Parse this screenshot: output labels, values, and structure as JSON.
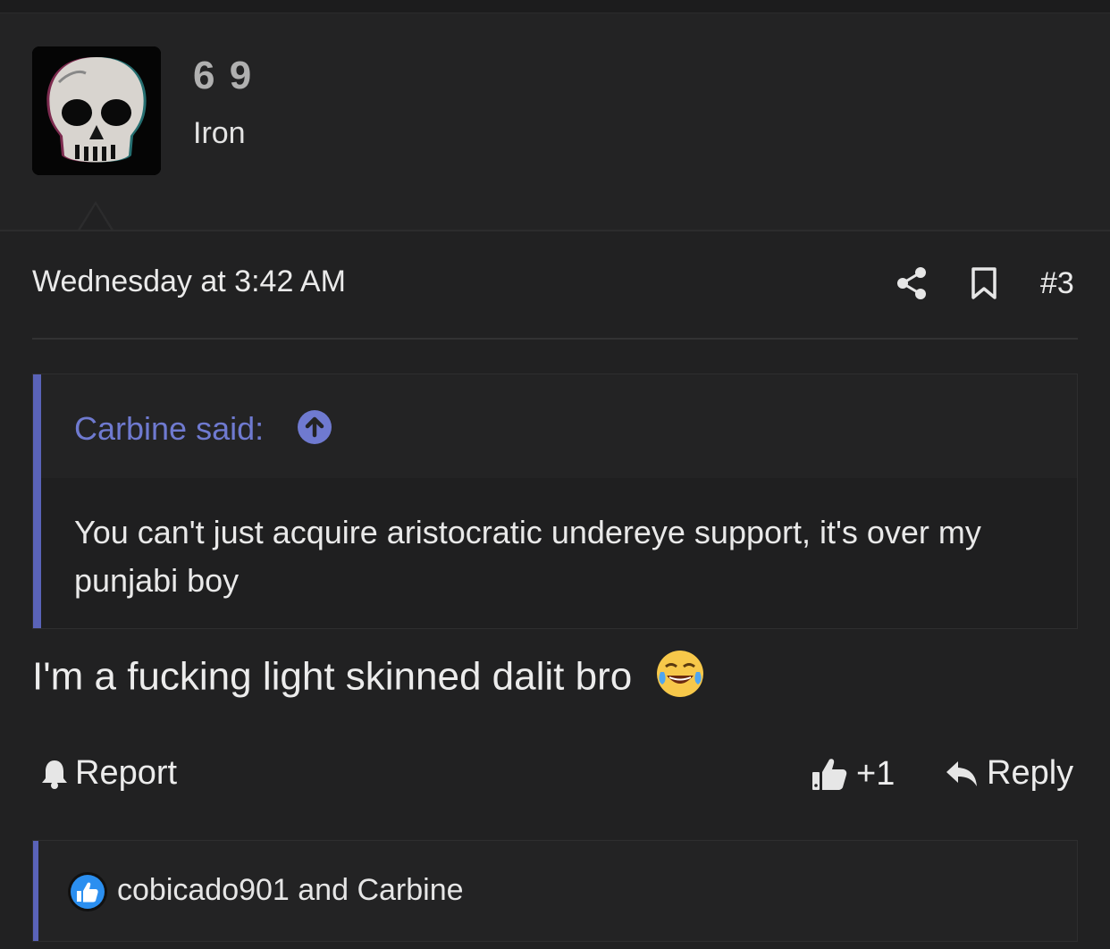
{
  "user": {
    "name": "6 9",
    "title": "Iron",
    "avatar_icon": "skull-avatar"
  },
  "post": {
    "date": "Wednesday at 3:42 AM",
    "number": "#3",
    "icons": [
      "share-icon",
      "bookmark-icon"
    ]
  },
  "quote": {
    "author": "Carbine said:",
    "text": "You can't just acquire aristocratic undereye support, it's over my punjabi boy",
    "accent_color": "#5a63b8"
  },
  "message": {
    "text": "I'm a fucking light skinned dalit bro",
    "emoji": "joy-emoji"
  },
  "actions": {
    "report_label": "Report",
    "like_label": "+1",
    "reply_label": "Reply"
  },
  "reactions": {
    "text": "cobicado901 and Carbine",
    "icon": "like-reaction-icon"
  },
  "colors": {
    "background": "#212122",
    "link": "#6f7ad0",
    "reaction_blue": "#2b8ff0"
  }
}
